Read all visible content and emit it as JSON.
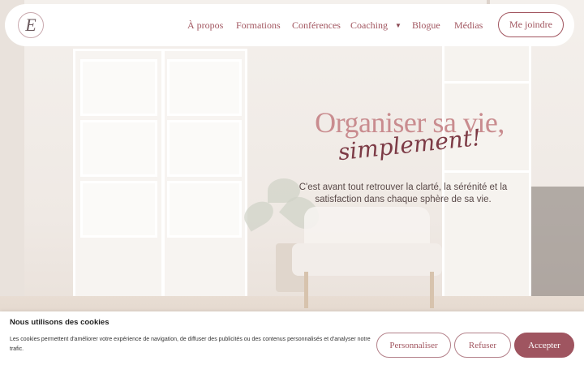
{
  "logo": {
    "letter": "E"
  },
  "nav": {
    "items": [
      {
        "label": "À propos"
      },
      {
        "label": "Formations"
      },
      {
        "label": "Conférences"
      },
      {
        "label": "Coaching",
        "has_dropdown": true
      },
      {
        "label": "Blogue"
      },
      {
        "label": "Médias"
      }
    ],
    "cta_label": "Me joindre"
  },
  "hero": {
    "title": "Organiser sa vie,",
    "script": "simplement!",
    "subtitle": "C'est avant tout retrouver la clarté, la sérénité et la satisfaction dans chaque sphère de sa vie."
  },
  "cookie_banner": {
    "title": "Nous utilisons des cookies",
    "text": "Les cookies permettent d'améliorer votre expérience de navigation, de diffuser des publicités ou des contenus personnalisés et d'analyser notre trafic.",
    "buttons": {
      "customize": "Personnaliser",
      "refuse": "Refuser",
      "accept": "Accepter"
    }
  },
  "colors": {
    "accent": "#a1555f",
    "accent_dark": "#9f5560",
    "title_pink": "#c98c8f"
  }
}
